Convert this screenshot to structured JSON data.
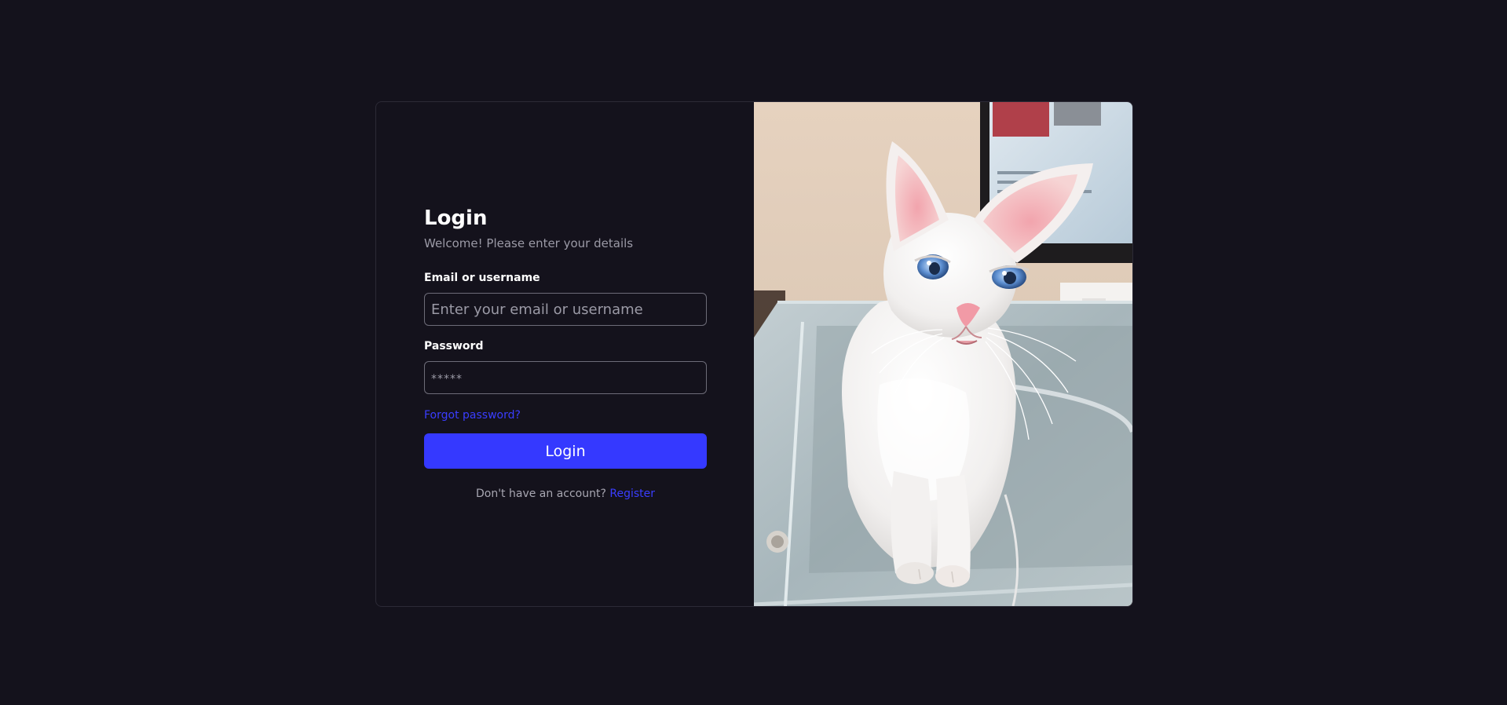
{
  "login": {
    "title": "Login",
    "subtitle": "Welcome! Please enter your details",
    "email_label": "Email or username",
    "email_placeholder": "Enter your email or username",
    "password_label": "Password",
    "password_placeholder": "*****",
    "forgot_password": "Forgot password?",
    "submit_label": "Login",
    "register_prompt": "Don't have an account?",
    "register_link": "Register"
  },
  "image": {
    "subject": "white-cat-photo"
  },
  "colors": {
    "background": "#14121c",
    "accent": "#3539ff",
    "link": "#3a3dff",
    "muted_text": "#9b9aa6"
  }
}
